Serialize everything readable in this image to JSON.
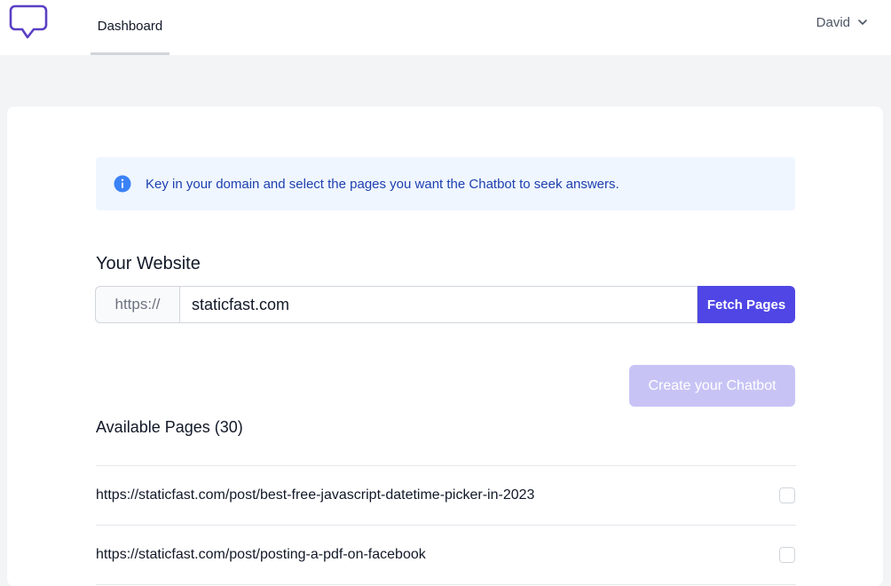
{
  "header": {
    "logo_icon": "speech-bubble-icon",
    "nav_tab": "Dashboard",
    "user_name": "David",
    "user_menu_icon": "chevron-down-icon"
  },
  "alert": {
    "icon": "info-icon",
    "text": "Key in your domain and select the pages you want the Chatbot to seek answers."
  },
  "website": {
    "title": "Your Website",
    "prefix": "https://",
    "value": "staticfast.com",
    "fetch_label": "Fetch Pages"
  },
  "create_label": "Create your Chatbot",
  "pages": {
    "title": "Available Pages (30)",
    "items": [
      {
        "url": "https://staticfast.com/post/best-free-javascript-datetime-picker-in-2023"
      },
      {
        "url": "https://staticfast.com/post/posting-a-pdf-on-facebook"
      }
    ]
  },
  "colors": {
    "accent": "#4f46e5",
    "accent_disabled": "#c7c4f5",
    "logo": "#5b3fc4",
    "info": "#3b82f6",
    "alert_bg": "#eff6ff"
  }
}
